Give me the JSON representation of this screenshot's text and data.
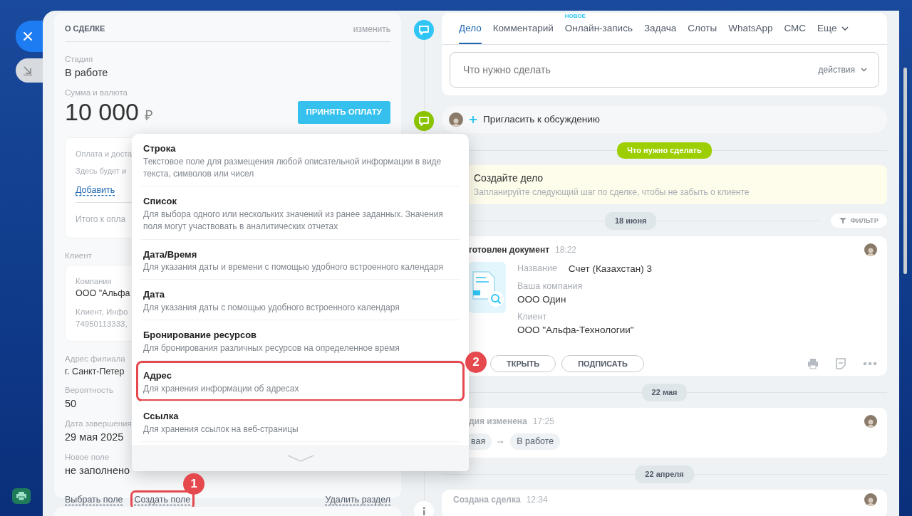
{
  "deal": {
    "title": "О СДЕЛКЕ",
    "edit": "изменить",
    "stage": {
      "label": "Стадия",
      "value": "В работе"
    },
    "amount": {
      "label": "Сумма и валюта",
      "value": "10 000",
      "currency": "₽",
      "button": "ПРИНЯТЬ ОПЛАТУ"
    },
    "payment": {
      "title": "Оплата и доста",
      "text": "Здесь будет и",
      "link": "Добавить",
      "total": "Итого к опла"
    },
    "client": {
      "label": "Клиент",
      "company_label": "Компания",
      "company": "ООО \"Альфа",
      "contact": "Клиент, Инфо",
      "phone": "74950113333,"
    },
    "fields": [
      {
        "label": "Адрес филиала",
        "value": "г. Санкт-Петер"
      },
      {
        "label": "Вероятность",
        "value": "50"
      },
      {
        "label": "Дата завершения",
        "value": "29 мая 2025"
      },
      {
        "label": "Новое поле",
        "value": "не заполнено"
      }
    ],
    "actions": [
      {
        "label": "Выбрать поле",
        "highlighted": false
      },
      {
        "label": "Создать поле",
        "highlighted": true,
        "callout": "1"
      },
      {
        "label": "Удалить раздел",
        "highlighted": false
      }
    ]
  },
  "field_menu": {
    "items": [
      {
        "title": "Строка",
        "description": "Текстовое поле для размещения любой описательной информации в виде текста, символов или чисел",
        "highlighted": false
      },
      {
        "title": "Список",
        "description": "Для выбора одного или нескольких значений из ранее заданных. Значения поля могут участвовать в аналитических отчетах",
        "highlighted": false
      },
      {
        "title": "Дата/Время",
        "description": "Для указания даты и времени с помощью удобного встроенного календаря",
        "highlighted": false
      },
      {
        "title": "Дата",
        "description": "Для указания даты с помощью удобного встроенного календаря",
        "highlighted": false
      },
      {
        "title": "Бронирование ресурсов",
        "description": "Для бронирования различных ресурсов на определенное время",
        "highlighted": false
      },
      {
        "title": "Адрес",
        "description": "Для хранения информации об адресах",
        "highlighted": true,
        "callout": "2"
      },
      {
        "title": "Ссылка",
        "description": "Для хранения ссылок на веб-страницы",
        "highlighted": false
      }
    ]
  },
  "timeline": {
    "tabs": [
      {
        "label": "Дело",
        "selected": true
      },
      {
        "label": "Комментарий",
        "selected": false
      },
      {
        "label": "Онлайн-запись",
        "selected": false,
        "badge": "НОВОЕ"
      },
      {
        "label": "Задача",
        "selected": false
      },
      {
        "label": "Слоты",
        "selected": false
      },
      {
        "label": "WhatsApp",
        "selected": false
      },
      {
        "label": "СМС",
        "selected": false
      },
      {
        "label": "Еще",
        "selected": false,
        "dropdown": true
      }
    ],
    "composer": {
      "placeholder": "Что нужно сделать",
      "actions": "действия"
    },
    "invite": "Пригласить к обсуждению",
    "todo_label": "Что нужно сделать",
    "todo": {
      "title": "Создайте дело",
      "text": "Запланируйте следующий шаг по сделке, чтобы не забыть о клиенте"
    },
    "filter": "ФИЛЬТР",
    "events": [
      {
        "date": "18 июня",
        "kind": "document",
        "title": "готовлен документ",
        "time": "18:22",
        "name_label": "Название",
        "name": "Счет (Казахстан) 3",
        "fields": [
          {
            "label": "Ваша компания",
            "value": "ООО Один"
          },
          {
            "label": "Клиент",
            "value": "ООО \"Альфа-Технологии\""
          }
        ],
        "buttons": [
          "ТКРЫТЬ",
          "ПОДПИСАТЬ"
        ]
      },
      {
        "date": "22 мая",
        "kind": "stage",
        "title": "дия изменена",
        "time": "17:25",
        "from": "вая",
        "to": "В работе"
      },
      {
        "date": "22 апреля",
        "kind": "created",
        "title": "Создана сделка",
        "time": "12:34"
      }
    ]
  }
}
